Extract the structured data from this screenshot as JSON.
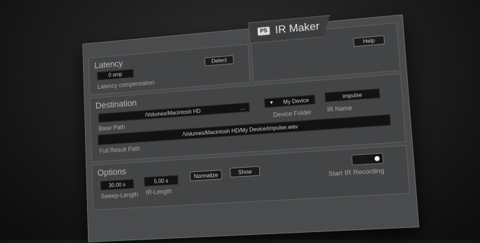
{
  "app": {
    "title": "IR Maker",
    "logo_text": "PS",
    "help_label": "Help"
  },
  "latency": {
    "section_title": "Latency",
    "value": "0 smp",
    "detect_label": "Detect",
    "field_label": "Latency compensation"
  },
  "destination": {
    "section_title": "Destination",
    "base_path": "/Volumes/Macintosh HD",
    "browse_label": "...",
    "base_path_label": "Base Path",
    "device_folder": "My Device",
    "device_folder_label": "Device Folder",
    "ir_name": "impulse",
    "ir_name_label": "IR Name",
    "full_result_path": "/Volumes/Macintosh HD/My Device/impulse.wav",
    "full_result_path_label": "Full Result Path"
  },
  "options": {
    "section_title": "Options",
    "sweep_length": "30.00 s",
    "sweep_length_label": "Sweep-Length",
    "ir_length": "5.00 s",
    "ir_length_label": "IR-Length",
    "normalize_label": "Normalize",
    "show_label": "Show",
    "start_recording_label": "Start IR Recording"
  },
  "icons": [
    "logo-icon",
    "dropdown-arrow-icon",
    "toggle-knob-icon"
  ]
}
